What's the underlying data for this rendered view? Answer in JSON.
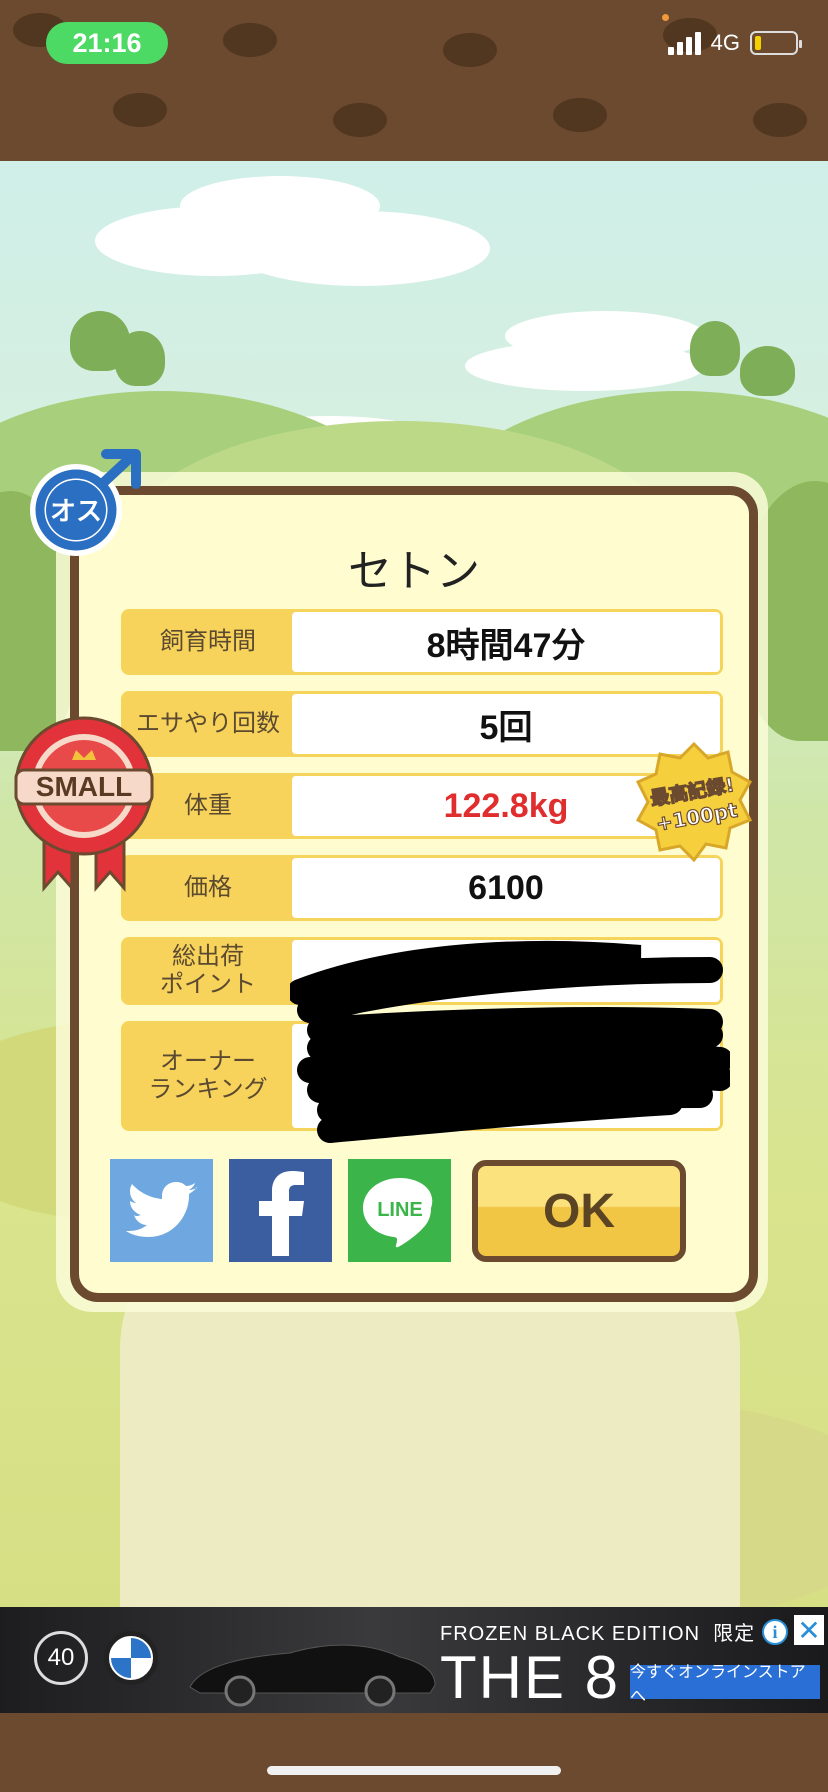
{
  "status_bar": {
    "time": "21:16",
    "network": "4G",
    "battery_level": 0.1
  },
  "colors": {
    "frame_brown": "#6b4a2f",
    "label_yellow": "#f7d35c",
    "weight_red": "#e02e2e",
    "time_green": "#4cd964"
  },
  "pet": {
    "name": "セトン"
  },
  "gender_badge": {
    "text": "オス",
    "icon": "male-symbol-icon"
  },
  "size_badge": {
    "text": "SMALL",
    "icon": "ribbon-icon"
  },
  "record_badge": {
    "line1": "最高記録!",
    "line2": "+100pt"
  },
  "stats": [
    {
      "label": "飼育時間",
      "value": "8時間47分"
    },
    {
      "label": "エサやり回数",
      "value": "5回"
    },
    {
      "label": "体重",
      "value": "122.8kg"
    },
    {
      "label": "価格",
      "value": "6100"
    },
    {
      "label_line1": "総出荷",
      "label_line2": "ポイント",
      "value": ""
    },
    {
      "label_line1": "オーナー",
      "label_line2": "ランキング",
      "value": ""
    }
  ],
  "share": {
    "twitter": "twitter-icon",
    "facebook": "facebook-icon",
    "line_label": "LINE"
  },
  "ok_label": "OK",
  "ad": {
    "badge_40": "40",
    "headline": "FROZEN BLACK EDITION",
    "limited": "限定",
    "product": "THE 8",
    "cta": "今すぐオンラインストアへ",
    "info": "i",
    "close": "✕"
  }
}
